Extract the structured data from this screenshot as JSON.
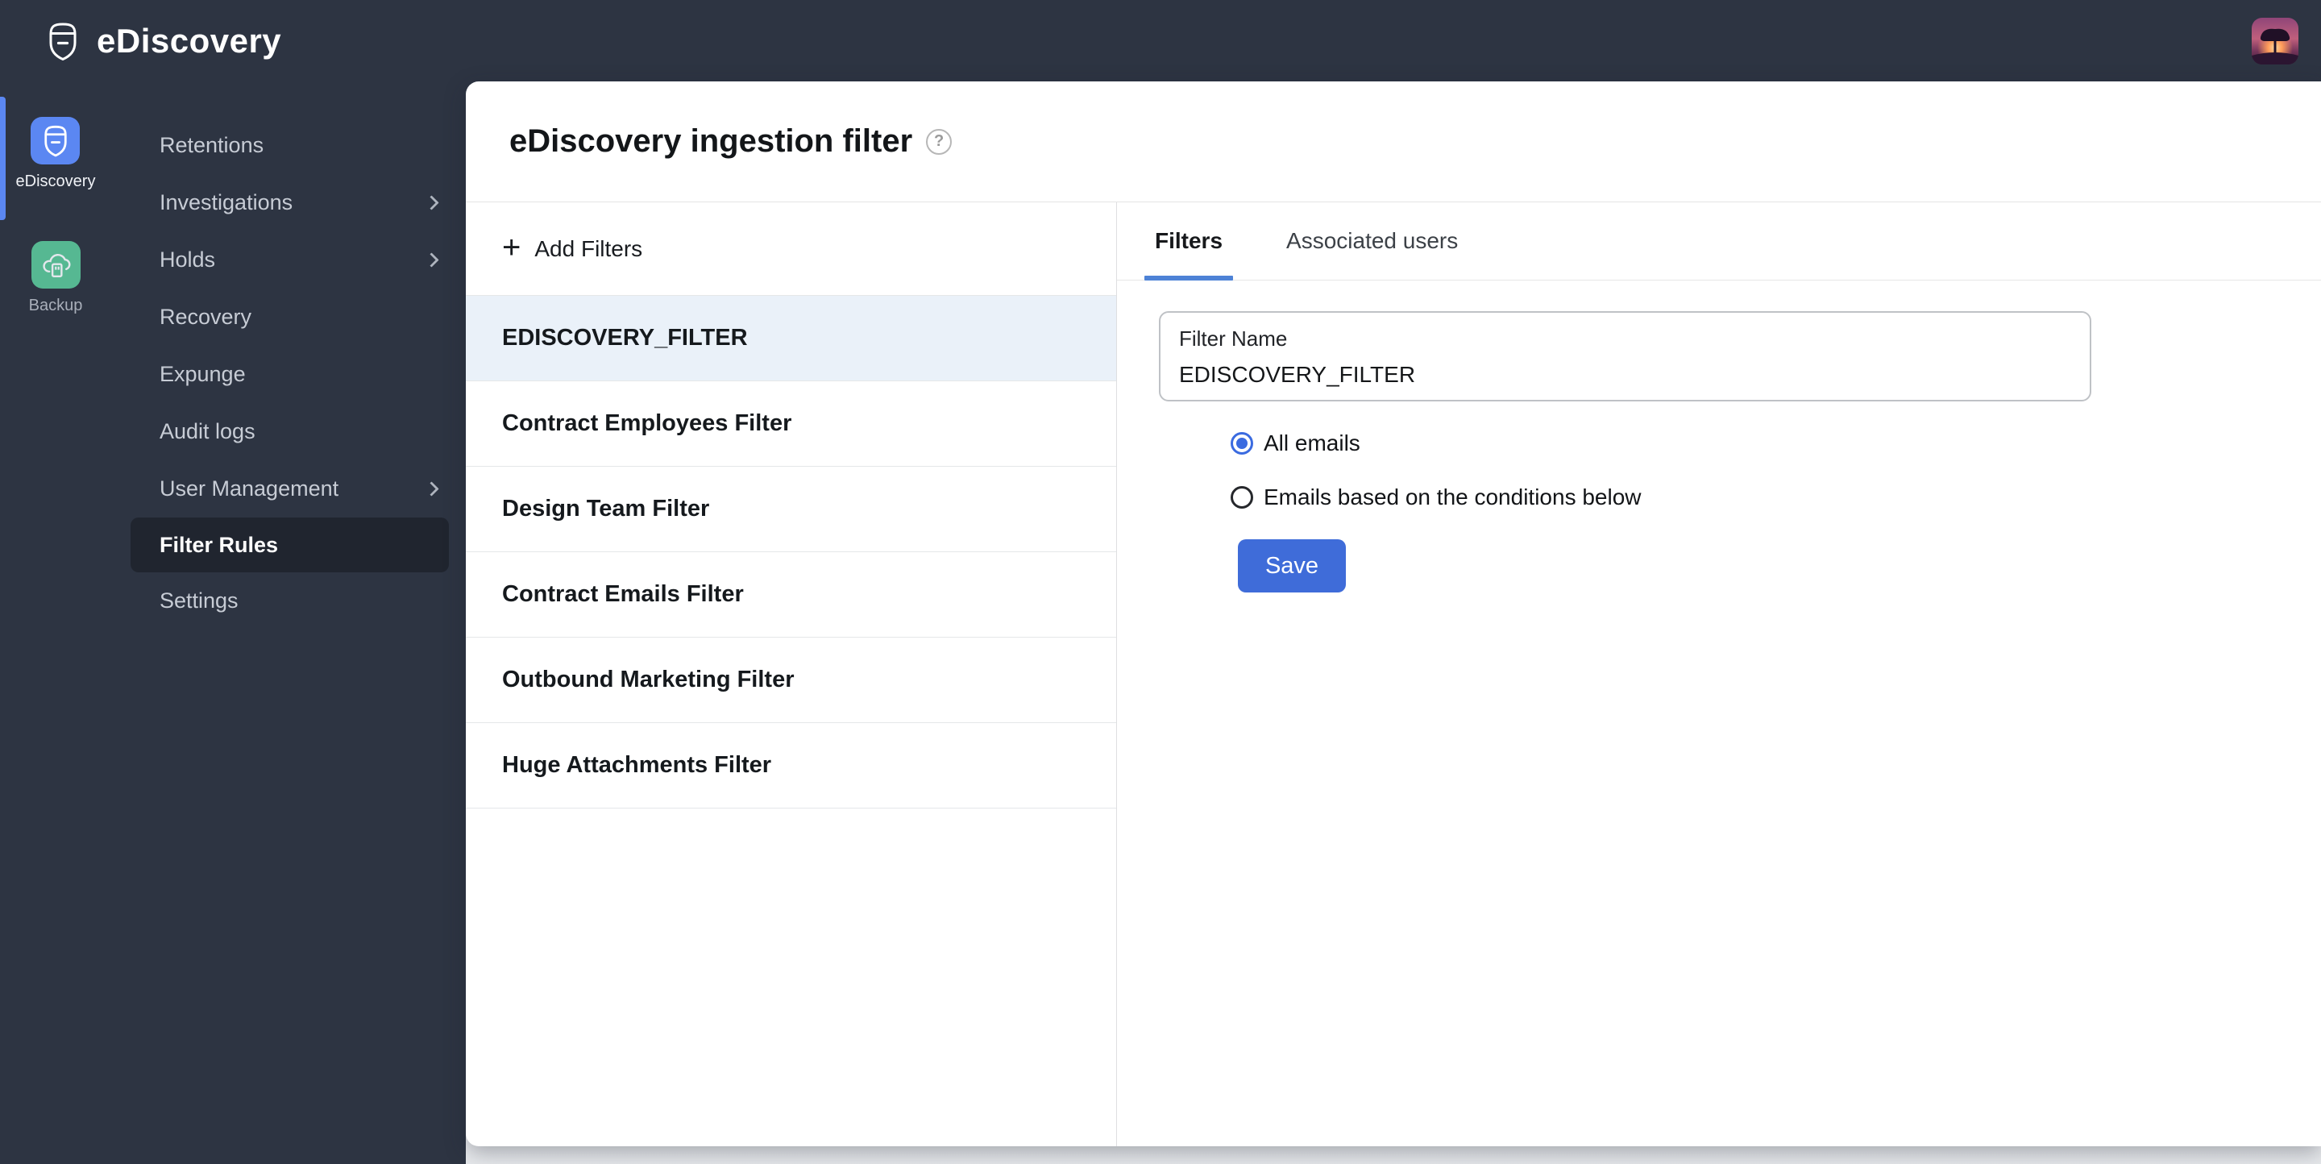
{
  "topbar": {
    "app_title": "eDiscovery"
  },
  "icon_rail": {
    "items": [
      {
        "label": "eDiscovery",
        "active": true
      },
      {
        "label": "Backup",
        "active": false
      }
    ]
  },
  "sidebar": {
    "items": [
      {
        "label": "Retentions",
        "chevron": false
      },
      {
        "label": "Investigations",
        "chevron": true
      },
      {
        "label": "Holds",
        "chevron": true
      },
      {
        "label": "Recovery",
        "chevron": false
      },
      {
        "label": "Expunge",
        "chevron": false
      },
      {
        "label": "Audit logs",
        "chevron": false
      },
      {
        "label": "User Management",
        "chevron": true
      },
      {
        "label": "Filter Rules",
        "chevron": false,
        "active": true
      },
      {
        "label": "Settings",
        "chevron": false
      }
    ]
  },
  "main": {
    "page_title": "eDiscovery ingestion filter",
    "icons": {
      "help": "?",
      "plus": "+"
    },
    "filter_list": {
      "add_button_label": "Add Filters",
      "items": [
        {
          "name": "EDISCOVERY_FILTER",
          "selected": true
        },
        {
          "name": "Contract Employees Filter",
          "selected": false
        },
        {
          "name": "Design Team Filter",
          "selected": false
        },
        {
          "name": "Contract Emails Filter",
          "selected": false
        },
        {
          "name": "Outbound Marketing Filter",
          "selected": false
        },
        {
          "name": "Huge Attachments Filter",
          "selected": false
        }
      ]
    },
    "detail": {
      "tabs": [
        {
          "label": "Filters",
          "active": true
        },
        {
          "label": "Associated users",
          "active": false
        }
      ],
      "filter_name": {
        "label": "Filter Name",
        "value": "EDISCOVERY_FILTER"
      },
      "radios": [
        {
          "label": "All emails",
          "selected": true
        },
        {
          "label": "Emails based on the conditions below",
          "selected": false
        }
      ],
      "save_label": "Save"
    }
  },
  "colors": {
    "chrome_bg": "#2d3442",
    "active_nav_bg": "#20252f",
    "accent_blue": "#5b87f2",
    "backup_green": "#56b892",
    "selected_row_bg": "#eaf1f9",
    "tab_underline": "#4d82d6",
    "save_button_bg": "#3f6cd9",
    "radio_selected": "#3b6be0"
  }
}
